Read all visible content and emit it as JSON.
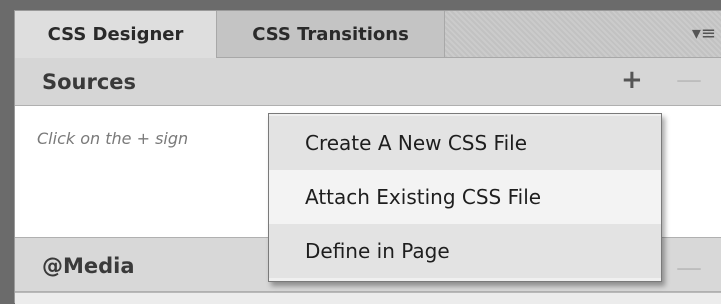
{
  "tabs": [
    {
      "label": "CSS Designer",
      "active": true
    },
    {
      "label": "CSS Transitions",
      "active": false
    }
  ],
  "panel_menu_icon": "▾≡",
  "sources": {
    "title": "Sources",
    "add_label": "+",
    "remove_label": "—",
    "hint": "Click on the + sign"
  },
  "media": {
    "title": "@Media",
    "remove_label": "—"
  },
  "menu": {
    "items": [
      "Create A New CSS File",
      "Attach Existing CSS File",
      "Define in Page"
    ]
  }
}
